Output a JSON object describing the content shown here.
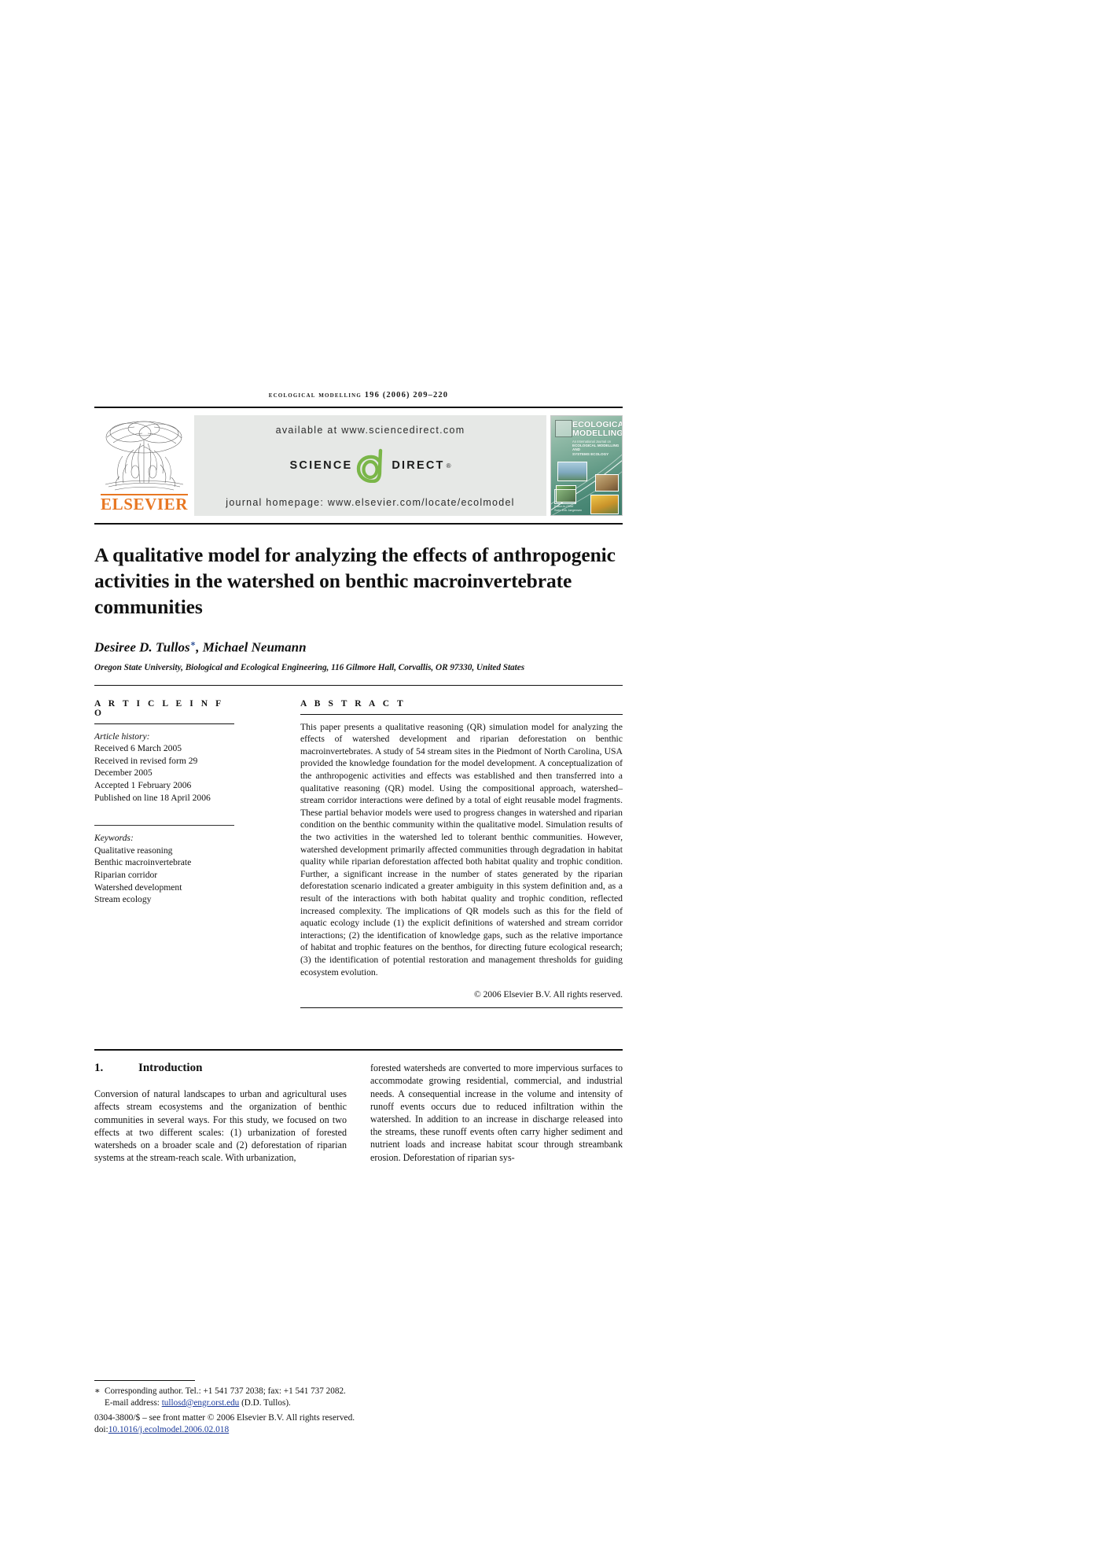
{
  "running_head": {
    "journal": "ecological modelling",
    "volume_issue": "196 (2006) 209–220"
  },
  "banner": {
    "elsevier_wordmark": "ELSEVIER",
    "available_at": "available at www.sciencedirect.com",
    "sciencedirect_left": "SCIENCE",
    "sciencedirect_right": "DIRECT",
    "registered_mark": "®",
    "journal_homepage": "journal homepage: www.elsevier.com/locate/ecolmodel",
    "accent_orange": "#E87722",
    "accent_green": "#7AB648",
    "banner_grey": "#e6e8e6"
  },
  "cover": {
    "title_line1": "ECOLOGICAL",
    "title_line2": "MODELLING",
    "subtitle": "An International Journal on",
    "subtitle2": "ECOLOGICAL MODELLING AND",
    "subtitle3": "SYSTEMS ECOLOGY",
    "editor_label": "Editor-in-Chief",
    "editor_name": "Sven Erik Jørgensen"
  },
  "article": {
    "title": "A qualitative model for analyzing the effects of anthropogenic activities in the watershed on benthic macroinvertebrate communities",
    "authors": "Desiree D. Tullos",
    "corresponding_marker": "∗",
    "authors_rest": ", Michael Neumann",
    "affiliation": "Oregon State University, Biological and Ecological Engineering, 116 Gilmore Hall, Corvallis, OR 97330, United States"
  },
  "article_info": {
    "heading": "A R T I C L E   I N F O",
    "history_label": "Article history:",
    "history": [
      "Received 6 March 2005",
      "Received in revised form 29",
      "December 2005",
      "Accepted 1 February 2006",
      "Published on line 18 April 2006"
    ],
    "keywords_label": "Keywords:",
    "keywords": [
      "Qualitative reasoning",
      "Benthic macroinvertebrate",
      "Riparian corridor",
      "Watershed development",
      "Stream ecology"
    ]
  },
  "abstract": {
    "heading": "A B S T R A C T",
    "text": "This paper presents a qualitative reasoning (QR) simulation model for analyzing the effects of watershed development and riparian deforestation on benthic macroinvertebrates. A study of 54 stream sites in the Piedmont of North Carolina, USA provided the knowledge foundation for the model development. A conceptualization of the anthropogenic activities and effects was established and then transferred into a qualitative reasoning (QR) model. Using the compositional approach, watershed–stream corridor interactions were defined by a total of eight reusable model fragments. These partial behavior models were used to progress changes in watershed and riparian condition on the benthic community within the qualitative model. Simulation results of the two activities in the watershed led to tolerant benthic communities. However, watershed development primarily affected communities through degradation in habitat quality while riparian deforestation affected both habitat quality and trophic condition. Further, a significant increase in the number of states generated by the riparian deforestation scenario indicated a greater ambiguity in this system definition and, as a result of the interactions with both habitat quality and trophic condition, reflected increased complexity. The implications of QR models such as this for the field of aquatic ecology include (1) the explicit definitions of watershed and stream corridor interactions; (2) the identification of knowledge gaps, such as the relative importance of habitat and trophic features on the benthos, for directing future ecological research; (3) the identification of potential restoration and management thresholds for guiding ecosystem evolution.",
    "copyright": "© 2006 Elsevier B.V. All rights reserved."
  },
  "body": {
    "section_number": "1.",
    "section_title": "Introduction",
    "left_paragraph": "Conversion of natural landscapes to urban and agricultural uses affects stream ecosystems and the organization of benthic communities in several ways. For this study, we focused on two effects at two different scales: (1) urbanization of forested watersheds on a broader scale and (2) deforestation of riparian systems at the stream-reach scale. With urbanization,",
    "right_paragraph": "forested watersheds are converted to more impervious surfaces to accommodate growing residential, commercial, and industrial needs. A consequential increase in the volume and intensity of runoff events occurs due to reduced infiltration within the watershed. In addition to an increase in discharge released into the streams, these runoff events often carry higher sediment and nutrient loads and increase habitat scour through streambank erosion. Deforestation of riparian sys-"
  },
  "footnotes": {
    "corresponding_marker": "∗",
    "corresponding": "Corresponding author. Tel.: +1 541 737 2038; fax: +1 541 737 2082.",
    "email_label": "E-mail address:",
    "email": "tullosd@engr.orst.edu",
    "email_suffix": "(D.D. Tullos).",
    "issn_line": "0304-3800/$ – see front matter © 2006 Elsevier B.V. All rights reserved.",
    "doi_label": "doi:",
    "doi": "10.1016/j.ecolmodel.2006.02.018"
  }
}
